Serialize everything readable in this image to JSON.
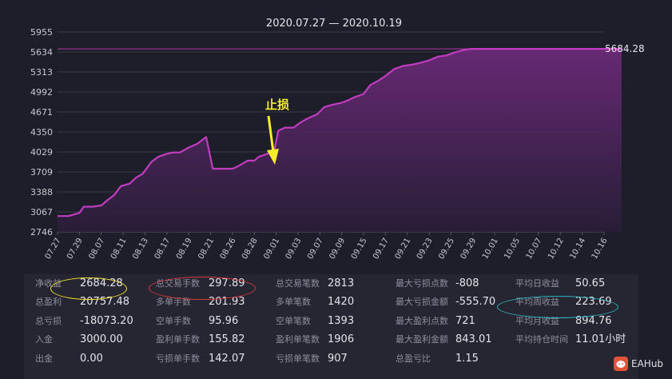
{
  "chart_data": {
    "type": "area",
    "title": "2020.07.27 — 2020.10.19",
    "yticks": [
      2746,
      3067,
      3388,
      3709,
      4029,
      4350,
      4671,
      4992,
      5313,
      5634,
      5955
    ],
    "ylim": [
      2746,
      5955
    ],
    "xticks": [
      "07.27",
      "07.29",
      "08.07",
      "08.11",
      "08.13",
      "08.17",
      "08.19",
      "08.21",
      "08.26",
      "08.28",
      "09.01",
      "09.03",
      "09.07",
      "09.09",
      "09.15",
      "09.17",
      "09.21",
      "09.23",
      "09.25",
      "09.29",
      "10.01",
      "10.05",
      "10.07",
      "10.12",
      "10.14",
      "10.16"
    ],
    "x": [
      0,
      0.5,
      1,
      1.2,
      1.6,
      2,
      2.3,
      2.6,
      2.9,
      3.3,
      3.6,
      3.9,
      4.3,
      4.6,
      5,
      5.3,
      5.6,
      6,
      6.4,
      6.8,
      7.1,
      7.6,
      8,
      8.2,
      8.7,
      9,
      9.2,
      9.6,
      9.9,
      10.1,
      10.4,
      10.8,
      11.1,
      11.4,
      11.9,
      12.2,
      12.6,
      13,
      13.3,
      13.6,
      14,
      14.3,
      14.7,
      15,
      15.4,
      15.8,
      16.2,
      16.6,
      17,
      17.4,
      17.8,
      18.2,
      18.5,
      18.9,
      19.3,
      19.6,
      20,
      20.3,
      20.7,
      21.1,
      21.5,
      21.8,
      22.2,
      22.6,
      23,
      23.3,
      23.6,
      23.9,
      24.2,
      24.6,
      24.9,
      25.2,
      25.5,
      25.8
    ],
    "values": [
      3000,
      3000,
      3050,
      3150,
      3150,
      3170,
      3260,
      3340,
      3480,
      3520,
      3620,
      3680,
      3870,
      3950,
      4000,
      4020,
      4020,
      4100,
      4160,
      4270,
      3760,
      3760,
      3760,
      3790,
      3890,
      3890,
      3950,
      4000,
      4030,
      4370,
      4420,
      4420,
      4500,
      4560,
      4640,
      4750,
      4790,
      4820,
      4860,
      4910,
      4960,
      5100,
      5180,
      5250,
      5360,
      5410,
      5430,
      5460,
      5500,
      5560,
      5580,
      5630,
      5660,
      5684,
      5684,
      5684,
      5684,
      5684,
      5684,
      5684,
      5684,
      5684,
      5684,
      5684,
      5684,
      5684,
      5684,
      5684,
      5684,
      5684,
      5684,
      5684,
      5684,
      5684
    ],
    "reference_line": 5684.28,
    "last_value_label": "5684.28",
    "annotation": "止损",
    "grid": true
  },
  "stats": {
    "col1": [
      {
        "label": "净收益",
        "value": "2684.28"
      },
      {
        "label": "总盈利",
        "value": "20757.48"
      },
      {
        "label": "总亏损",
        "value": "-18073.20"
      },
      {
        "label": "入金",
        "value": "3000.00"
      },
      {
        "label": "出金",
        "value": "0.00"
      }
    ],
    "col2": [
      {
        "label": "总交易手数",
        "value": "297.89"
      },
      {
        "label": "多单手数",
        "value": "201.93"
      },
      {
        "label": "空单手数",
        "value": "95.96"
      },
      {
        "label": "盈利单手数",
        "value": "155.82"
      },
      {
        "label": "亏损单手数",
        "value": "142.07"
      }
    ],
    "col3": [
      {
        "label": "总交易笔数",
        "value": "2813"
      },
      {
        "label": "多单笔数",
        "value": "1420"
      },
      {
        "label": "空单笔数",
        "value": "1393"
      },
      {
        "label": "盈利单笔数",
        "value": "1906"
      },
      {
        "label": "亏损单笔数",
        "value": "907"
      }
    ],
    "col4": [
      {
        "label": "最大亏损点数",
        "value": "-808"
      },
      {
        "label": "最大亏损金额",
        "value": "-555.70"
      },
      {
        "label": "最大盈利点数",
        "value": "721"
      },
      {
        "label": "最大盈利金额",
        "value": "843.01"
      },
      {
        "label": "总盈亏比",
        "value": "1.15"
      }
    ],
    "col5": [
      {
        "label": "平均日收益",
        "value": "50.65"
      },
      {
        "label": "平均周收益",
        "value": "223.69"
      },
      {
        "label": "平均月收益",
        "value": "894.76"
      },
      {
        "label": "平均持仓时间",
        "value": "11.01小时"
      }
    ]
  },
  "brand": {
    "name": "EAHub",
    "icon": "pig-icon"
  },
  "highlights": {
    "yellow": "#f2e233",
    "red": "#d83a3a",
    "teal": "#2fb6c0"
  }
}
